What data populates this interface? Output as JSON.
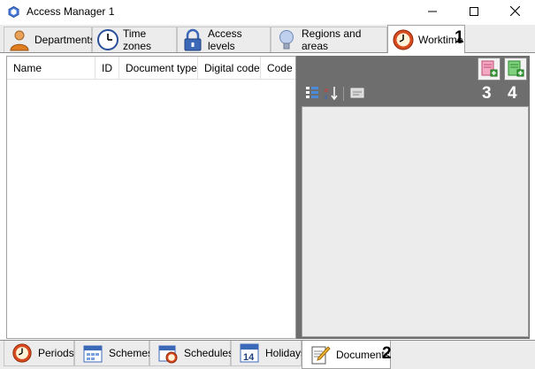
{
  "window": {
    "title": "Access Manager 1",
    "icon": "app-cube-icon",
    "controls": [
      "minimize-icon",
      "maximize-icon",
      "close-icon"
    ]
  },
  "top_tabs": [
    {
      "label": "Departments",
      "icon": "person-icon"
    },
    {
      "label": "Time zones",
      "icon": "clock-icon"
    },
    {
      "label": "Access levels",
      "icon": "padlock-icon"
    },
    {
      "label": "Regions and areas",
      "icon": "lightbulb-icon"
    },
    {
      "label": "Worktime",
      "icon": "red-clock-icon",
      "active": true
    }
  ],
  "grid": {
    "columns": [
      "Name",
      "ID",
      "Document type",
      "Digital code",
      "Code"
    ],
    "rows": []
  },
  "right_panel": {
    "buttons": [
      {
        "name": "add-document-pink",
        "icon": "pink-document-add-icon"
      },
      {
        "name": "add-document-green",
        "icon": "green-document-add-icon"
      }
    ],
    "toolbar": [
      "grid-view-icon",
      "sort-icon",
      "card-icon"
    ]
  },
  "bottom_tabs": [
    {
      "label": "Periods",
      "icon": "red-clock-icon"
    },
    {
      "label": "Schemes",
      "icon": "calendar-icon"
    },
    {
      "label": "Schedules",
      "icon": "calendar-clock-icon"
    },
    {
      "label": "Holidays",
      "icon": "calendar-14-icon"
    },
    {
      "label": "Documents",
      "icon": "document-pencil-icon",
      "active": true
    }
  ],
  "markers": [
    "1",
    "2",
    "3",
    "4"
  ],
  "colors": {
    "panel_dark": "#6e6e6e",
    "panel_light": "#ececec",
    "active_tab": "#ffffff"
  }
}
